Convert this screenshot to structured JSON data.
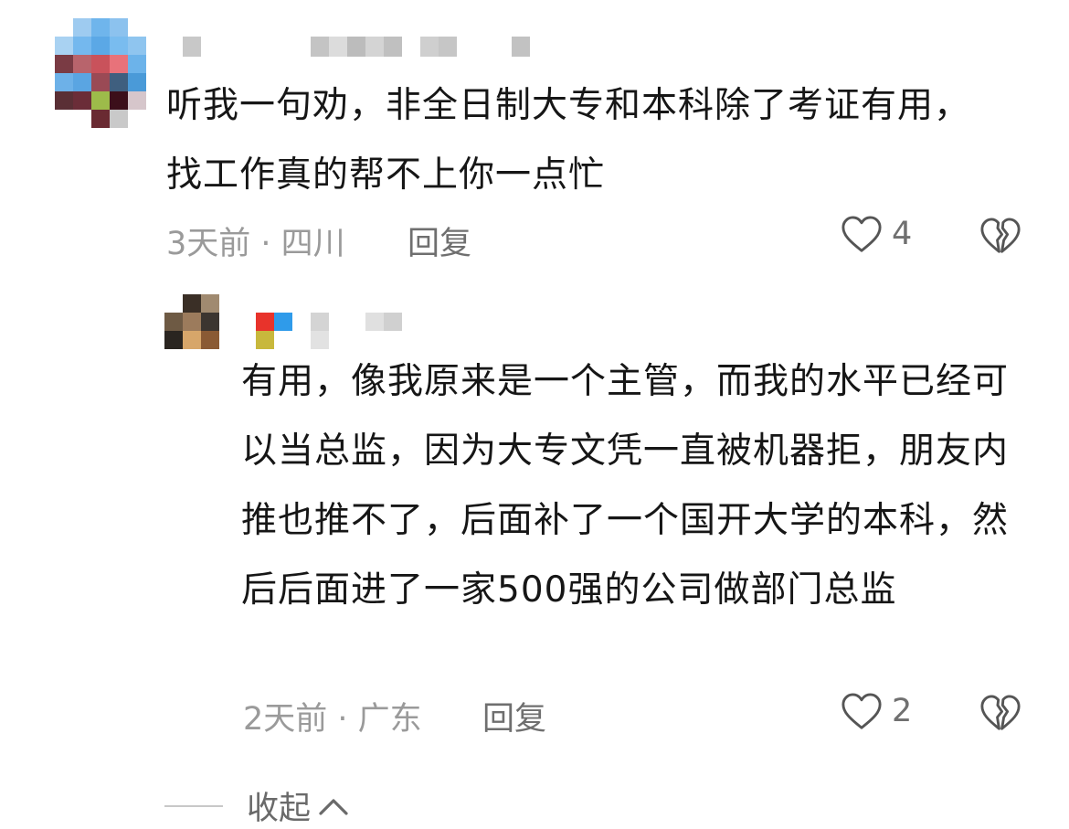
{
  "comments": [
    {
      "text": "听我一句劝，非全日制大专和本科除了考证有用，找工作真的帮不上你一点忙",
      "meta": "3天前 · 四川",
      "reply_label": "回复",
      "likes": "4",
      "avatar_icon": "pixelated-avatar",
      "username_icon": "pixelated-username"
    },
    {
      "text": "有用，像我原来是一个主管，而我的水平已经可以当总监，因为大专文凭一直被机器拒，朋友内推也推不了，后面补了一个国开大学的本科，然后后面进了一家500强的公司做部门总监",
      "meta": "2天前 · 广东",
      "reply_label": "回复",
      "likes": "2",
      "avatar_icon": "pixelated-avatar",
      "username_icon": "pixelated-username"
    }
  ],
  "collapse_label": "收起",
  "icons": {
    "like": "heart-outline-icon",
    "dislike": "broken-heart-outline-icon",
    "collapse": "chevron-up-icon"
  },
  "colors": {
    "text": "#161616",
    "meta": "#9a9a9a",
    "reply": "#6f6f6f",
    "icon": "#555555"
  }
}
